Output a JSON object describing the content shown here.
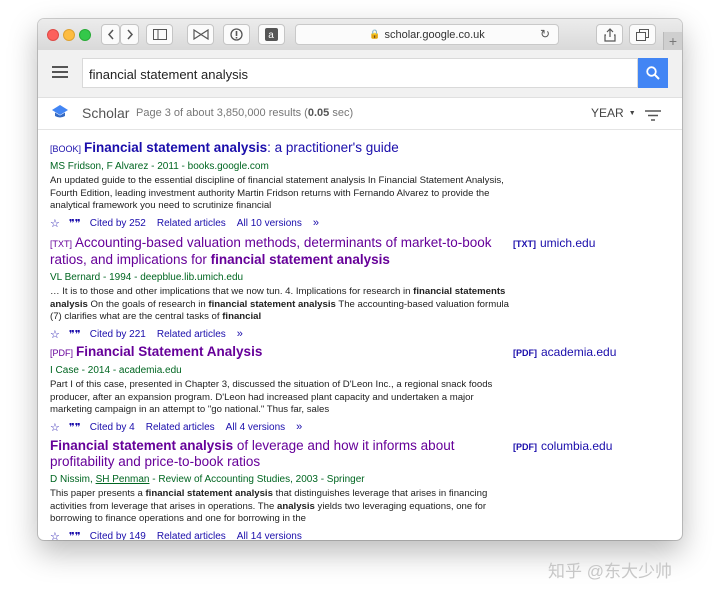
{
  "browser": {
    "url": "scholar.google.co.uk"
  },
  "search": {
    "query": "financial statement analysis"
  },
  "scholar": {
    "brand": "Scholar",
    "count_prefix": "Page 3 of about 3,850,000 results (",
    "count_time": "0.05",
    "count_suffix": " sec)",
    "year_label": "YEAR"
  },
  "results": [
    {
      "tag": "[BOOK]",
      "title_main": "Financial statement analysis",
      "title_rest": ": a practitioner's guide",
      "authors": "MS Fridson, F Alvarez - 2011 - books.google.com",
      "snippet": "An updated guide to the essential discipline of financial statement analysis In Financial Statement Analysis, Fourth Edition, leading investment authority Martin Fridson returns with Fernando Alvarez to provide the analytical framework you need to scrutinize financial",
      "cited": "Cited by 252",
      "related": "Related articles",
      "versions": "All 10 versions"
    },
    {
      "tag": "[TXT]",
      "title_a": "Accounting-based valuation methods, determinants of market-to-book ratios, and implications for ",
      "title_b": "financial statement analysis",
      "authors": "VL Bernard - 1994 - deepblue.lib.umich.edu",
      "snippet_a": "… It is to those and other implications that we now tun. 4. Implications for research in ",
      "snippet_b": "financial statements analysis",
      "snippet_c": " On the goals of research in ",
      "snippet_d": "financial statement analysis",
      "snippet_e": " The accounting-based valuation formula (7) clarifies what are the central tasks of ",
      "snippet_f": "financial",
      "cited": "Cited by 221",
      "related": "Related articles",
      "side_tag": "[TXT]",
      "side_link": "umich.edu"
    },
    {
      "tag": "[PDF]",
      "title": "Financial Statement Analysis",
      "authors": "I Case - 2014 - academia.edu",
      "snippet": "Part I of this case, presented in Chapter 3, discussed the situation of D'Leon Inc., a regional snack foods producer, after an expansion program. D'Leon had increased plant capacity and undertaken a major marketing campaign in an attempt to \"go national.\" Thus far, sales",
      "cited": "Cited by 4",
      "related": "Related articles",
      "versions": "All 4 versions",
      "side_tag": "[PDF]",
      "side_link": "academia.edu"
    },
    {
      "title_a": "Financial statement analysis",
      "title_b": " of leverage and how it informs about profitability and price-to-book ratios",
      "authors_a": "D Nissim, ",
      "authors_b": "SH Penman",
      "authors_c": " - Review of Accounting Studies, 2003 - Springer",
      "snippet_a": "This paper presents a ",
      "snippet_b": "financial statement analysis",
      "snippet_c": " that distinguishes leverage that arises in financing activities from leverage that arises in operations. The ",
      "snippet_d": "analysis",
      "snippet_e": " yields two leveraging equations, one for borrowing to finance operations and one for borrowing in the",
      "cited": "Cited by 149",
      "related": "Related articles",
      "versions": "All 14 versions",
      "side_tag": "[PDF]",
      "side_link": "columbia.edu"
    }
  ],
  "watermark": "知乎 @东大少帅"
}
